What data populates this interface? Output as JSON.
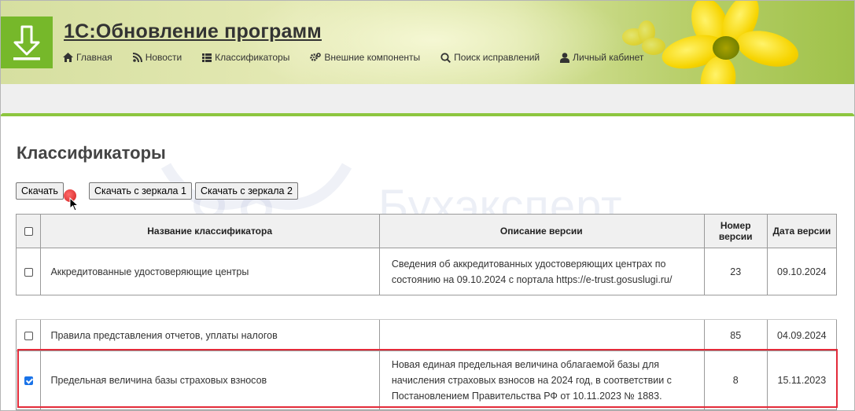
{
  "site": {
    "title": "1С:Обновление программ",
    "logo_icon": "download-icon",
    "accent_color": "#76b82a"
  },
  "nav": [
    {
      "label": "Главная",
      "icon": "home-icon"
    },
    {
      "label": "Новости",
      "icon": "rss-icon"
    },
    {
      "label": "Классификаторы",
      "icon": "list-icon"
    },
    {
      "label": "Внешние компоненты",
      "icon": "gears-icon"
    },
    {
      "label": "Поиск исправлений",
      "icon": "search-icon"
    },
    {
      "label": "Личный кабинет",
      "icon": "user-icon"
    }
  ],
  "page": {
    "heading": "Классификаторы",
    "watermark": "Бухэксперт"
  },
  "buttons": {
    "download": "Скачать",
    "mirror1": "Скачать с зеркала 1",
    "mirror2": "Скачать с зеркала 2"
  },
  "table": {
    "headers": {
      "name": "Название классификатора",
      "description": "Описание версии",
      "version": "Номер версии",
      "date": "Дата версии"
    },
    "rows": [
      {
        "checked": false,
        "name": "Аккредитованные удостоверяющие центры",
        "description": "Сведения об аккредитованных удостоверяющих центрах по состоянию на 09.10.2024 с портала https://e-trust.gosuslugi.ru/",
        "version": "23",
        "date": "09.10.2024"
      },
      {
        "checked": false,
        "name": "Правила представления отчетов, уплаты налогов",
        "description": "",
        "version": "85",
        "date": "04.09.2024"
      },
      {
        "checked": true,
        "name": "Предельная величина базы страховых взносов",
        "description": "Новая единая предельная величина облагаемой базы для начисления страховых взносов на 2024 год, в соответствии с Постановлением Правительства РФ от 10.11.2023 № 1883.",
        "version": "8",
        "date": "15.11.2023"
      }
    ]
  }
}
